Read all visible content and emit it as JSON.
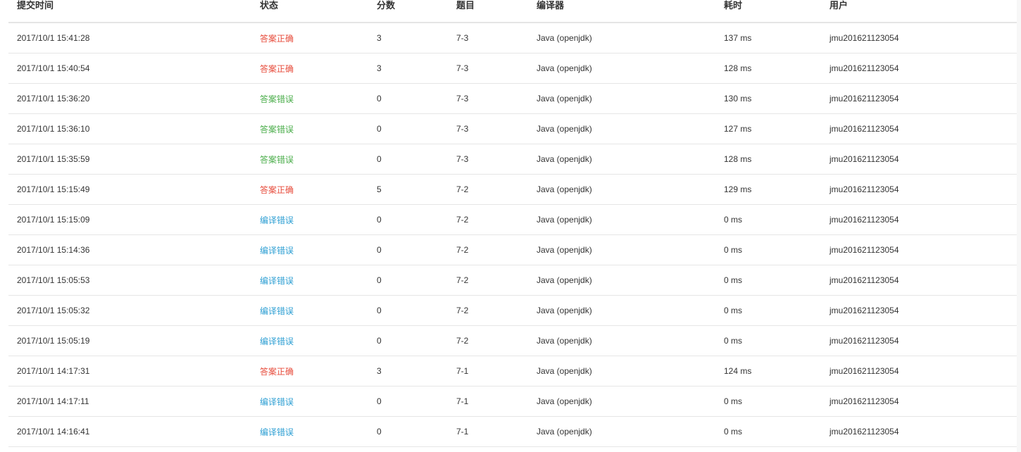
{
  "headers": {
    "time": "提交时间",
    "status": "状态",
    "score": "分数",
    "problem": "题目",
    "compiler": "编译器",
    "elapsed": "耗时",
    "user": "用户"
  },
  "status_colors": {
    "答案正确": "#e74c3c",
    "答案错误": "#4cae4c",
    "编译错误": "#2e9fd3"
  },
  "rows": [
    {
      "time": "2017/10/1 15:41:28",
      "status": "答案正确",
      "score": "3",
      "problem": "7-3",
      "compiler": "Java (openjdk)",
      "elapsed": "137 ms",
      "user": "jmu201621123054"
    },
    {
      "time": "2017/10/1 15:40:54",
      "status": "答案正确",
      "score": "3",
      "problem": "7-3",
      "compiler": "Java (openjdk)",
      "elapsed": "128 ms",
      "user": "jmu201621123054"
    },
    {
      "time": "2017/10/1 15:36:20",
      "status": "答案错误",
      "score": "0",
      "problem": "7-3",
      "compiler": "Java (openjdk)",
      "elapsed": "130 ms",
      "user": "jmu201621123054"
    },
    {
      "time": "2017/10/1 15:36:10",
      "status": "答案错误",
      "score": "0",
      "problem": "7-3",
      "compiler": "Java (openjdk)",
      "elapsed": "127 ms",
      "user": "jmu201621123054"
    },
    {
      "time": "2017/10/1 15:35:59",
      "status": "答案错误",
      "score": "0",
      "problem": "7-3",
      "compiler": "Java (openjdk)",
      "elapsed": "128 ms",
      "user": "jmu201621123054"
    },
    {
      "time": "2017/10/1 15:15:49",
      "status": "答案正确",
      "score": "5",
      "problem": "7-2",
      "compiler": "Java (openjdk)",
      "elapsed": "129 ms",
      "user": "jmu201621123054"
    },
    {
      "time": "2017/10/1 15:15:09",
      "status": "编译错误",
      "score": "0",
      "problem": "7-2",
      "compiler": "Java (openjdk)",
      "elapsed": "0 ms",
      "user": "jmu201621123054"
    },
    {
      "time": "2017/10/1 15:14:36",
      "status": "编译错误",
      "score": "0",
      "problem": "7-2",
      "compiler": "Java (openjdk)",
      "elapsed": "0 ms",
      "user": "jmu201621123054"
    },
    {
      "time": "2017/10/1 15:05:53",
      "status": "编译错误",
      "score": "0",
      "problem": "7-2",
      "compiler": "Java (openjdk)",
      "elapsed": "0 ms",
      "user": "jmu201621123054"
    },
    {
      "time": "2017/10/1 15:05:32",
      "status": "编译错误",
      "score": "0",
      "problem": "7-2",
      "compiler": "Java (openjdk)",
      "elapsed": "0 ms",
      "user": "jmu201621123054"
    },
    {
      "time": "2017/10/1 15:05:19",
      "status": "编译错误",
      "score": "0",
      "problem": "7-2",
      "compiler": "Java (openjdk)",
      "elapsed": "0 ms",
      "user": "jmu201621123054"
    },
    {
      "time": "2017/10/1 14:17:31",
      "status": "答案正确",
      "score": "3",
      "problem": "7-1",
      "compiler": "Java (openjdk)",
      "elapsed": "124 ms",
      "user": "jmu201621123054"
    },
    {
      "time": "2017/10/1 14:17:11",
      "status": "编译错误",
      "score": "0",
      "problem": "7-1",
      "compiler": "Java (openjdk)",
      "elapsed": "0 ms",
      "user": "jmu201621123054"
    },
    {
      "time": "2017/10/1 14:16:41",
      "status": "编译错误",
      "score": "0",
      "problem": "7-1",
      "compiler": "Java (openjdk)",
      "elapsed": "0 ms",
      "user": "jmu201621123054"
    }
  ]
}
